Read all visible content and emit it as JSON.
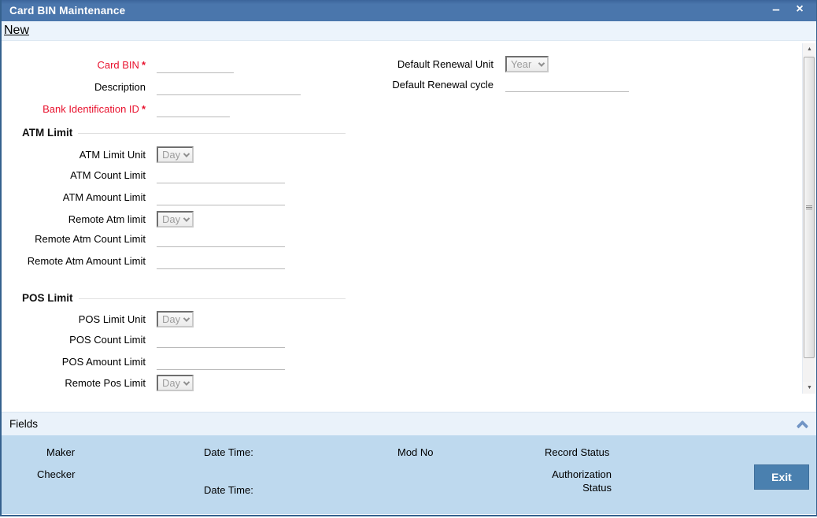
{
  "window": {
    "title": "Card BIN Maintenance"
  },
  "titlebar": {
    "minimize_icon": "–",
    "close_icon": "×"
  },
  "actions": {
    "new_label": "New"
  },
  "form": {
    "card_bin": {
      "label": "Card BIN",
      "required_mark": "*",
      "value": ""
    },
    "description": {
      "label": "Description",
      "value": ""
    },
    "bank_identification_id": {
      "label": "Bank Identification ID",
      "required_mark": "*",
      "value": ""
    },
    "default_renewal_unit": {
      "label": "Default Renewal Unit",
      "value": "Year"
    },
    "default_renewal_cycle": {
      "label": "Default Renewal cycle",
      "value": ""
    }
  },
  "atm_limit": {
    "section_title": "ATM Limit",
    "atm_limit_unit": {
      "label": "ATM Limit Unit",
      "value": "Day"
    },
    "atm_count_limit": {
      "label": "ATM Count Limit",
      "value": ""
    },
    "atm_amount_limit": {
      "label": "ATM Amount Limit",
      "value": ""
    },
    "remote_atm_limit": {
      "label": "Remote Atm limit",
      "value": "Day"
    },
    "remote_atm_count_limit": {
      "label": "Remote Atm Count Limit",
      "value": ""
    },
    "remote_atm_amount_limit": {
      "label": "Remote Atm Amount Limit",
      "value": ""
    }
  },
  "pos_limit": {
    "section_title": "POS Limit",
    "pos_limit_unit": {
      "label": "POS Limit Unit",
      "value": "Day"
    },
    "pos_count_limit": {
      "label": "POS Count Limit",
      "value": ""
    },
    "pos_amount_limit": {
      "label": "POS Amount Limit",
      "value": ""
    },
    "remote_pos_limit": {
      "label": "Remote Pos Limit",
      "value": "Day"
    }
  },
  "fields_bar": {
    "label": "Fields"
  },
  "footer": {
    "maker_label": "Maker",
    "checker_label": "Checker",
    "date_time_1_label": "Date Time:",
    "date_time_2_label": "Date Time:",
    "mod_no_label": "Mod No",
    "record_status_label": "Record Status",
    "authorization_status_label": "Authorization Status",
    "exit_button_label": "Exit"
  },
  "scrollbar": {
    "up_icon": "▲",
    "down_icon": "▼"
  },
  "colors": {
    "titlebar_blue": "#4a76ac",
    "footer_blue": "#bed9ee",
    "fields_bar_blue": "#eaf2fa",
    "exit_button_blue": "#4a80af",
    "required_red": "#e8112d"
  }
}
